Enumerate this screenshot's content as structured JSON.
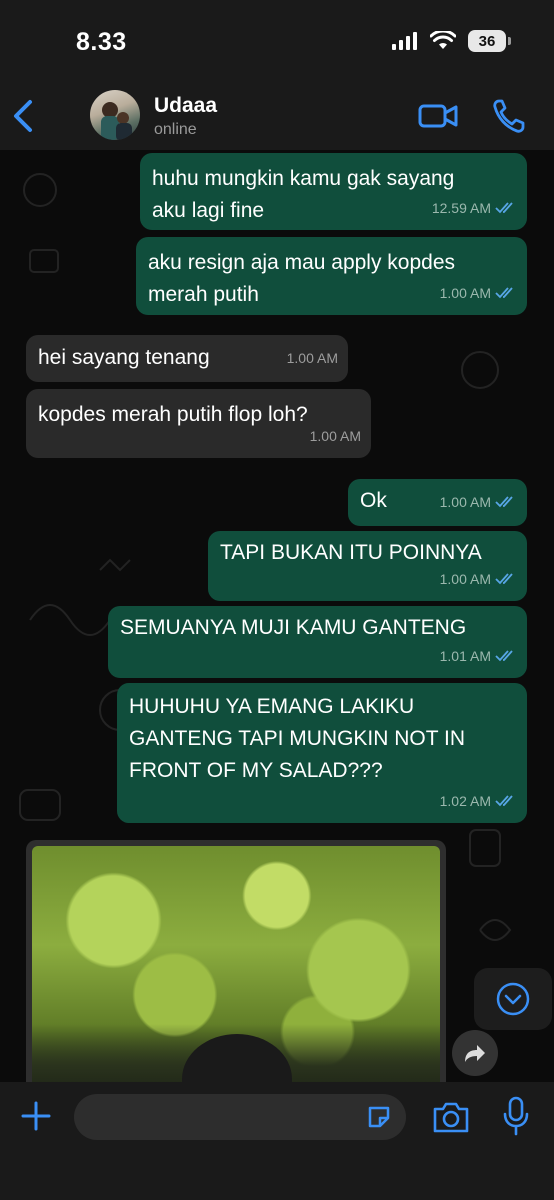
{
  "status_bar": {
    "time": "8.33",
    "battery": "36"
  },
  "header": {
    "contact_name": "Udaaa",
    "contact_status": "online"
  },
  "messages": [
    {
      "dir": "out",
      "lines": [
        "huhu mungkin kamu gak sayang",
        "aku lagi fine"
      ],
      "time": "12.59 AM",
      "ticks": true
    },
    {
      "dir": "out",
      "lines": [
        "aku resign aja mau apply kopdes",
        "merah putih"
      ],
      "time": "1.00 AM",
      "ticks": true
    },
    {
      "dir": "in",
      "lines": [
        "hei sayang tenang"
      ],
      "time": "1.00 AM"
    },
    {
      "dir": "in",
      "lines": [
        "kopdes merah putih flop loh?"
      ],
      "time": "1.00 AM"
    },
    {
      "dir": "out",
      "lines": [
        "Ok"
      ],
      "time": "1.00 AM",
      "ticks": true
    },
    {
      "dir": "out",
      "lines": [
        "TAPI BUKAN ITU POINNYA"
      ],
      "time": "1.00 AM",
      "ticks": true
    },
    {
      "dir": "out",
      "lines": [
        "SEMUANYA MUJI KAMU GANTENG"
      ],
      "time": "1.01 AM",
      "ticks": true
    },
    {
      "dir": "out",
      "lines": [
        "HUHUHU YA EMANG LAKIKU",
        "GANTENG TAPI MUNGKIN NOT IN",
        "FRONT OF MY SALAD???"
      ],
      "time": "1.02 AM",
      "ticks": true
    }
  ],
  "composer": {
    "placeholder": ""
  },
  "icons": {
    "back": "chevron-left-icon",
    "video": "video-camera-icon",
    "call": "phone-icon",
    "scroll": "chevron-down-circle-icon",
    "forward": "forward-arrow-icon",
    "plus": "plus-icon",
    "sticker": "sticker-icon",
    "camera": "camera-icon",
    "mic": "microphone-icon"
  },
  "colors": {
    "accent": "#3a8ff5",
    "outgoing_bubble": "#104e3c",
    "incoming_bubble": "#2a2a2a",
    "read_ticks": "#58a6e6"
  }
}
